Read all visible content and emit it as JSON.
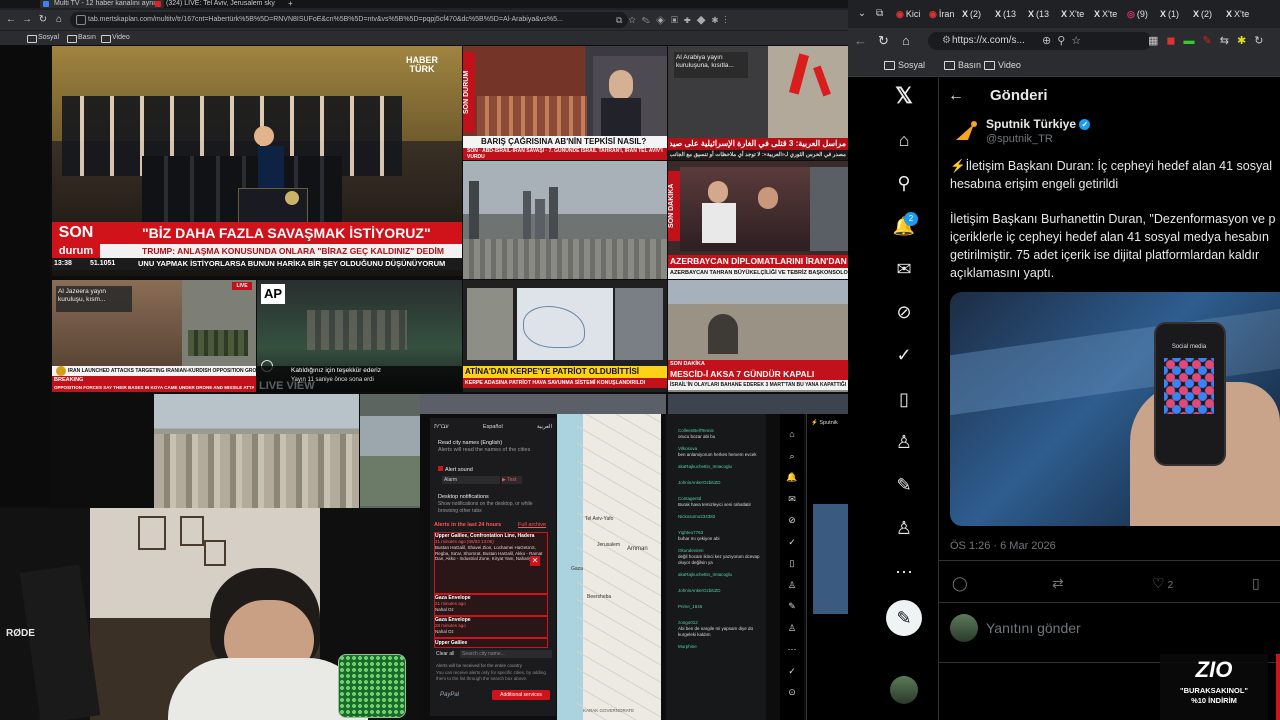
{
  "left_browser": {
    "tabs": [
      {
        "label": "Multi TV - 12 haber kanalını aynı e",
        "color": "#3b82f6",
        "active": true
      },
      {
        "label": "(324) LIVE: Tel Aviv, Jerusalem sky",
        "color": "#e11d2a",
        "active": false
      }
    ],
    "url": "tab.mertskaplan.com/multitv/tr/167cnt=Habertürk%5B%5D=RNVN8ISUFoE&cn%5B%5D=ntv&vs%5B%5D=pqpj5cf470&dc%5B%5D=Al-Arabiya&vs%5...",
    "bookmarks": [
      "Sosyal",
      "Basın",
      "Video"
    ]
  },
  "tiles": {
    "haberturk": {
      "logo_line1": "HABER",
      "logo_line2": "TÜRK",
      "son": "SON",
      "durum": "durum",
      "headline": "\"BİZ DAHA FAZLA SAVAŞMAK İSTİYORUZ\"",
      "subline": "TRUMP: ANLAŞMA KONUSUNDA ONLARA \"BİRAZ GEÇ KALDINIZ\" DEDİM",
      "time": "13:38",
      "ticker_value": "51.1051",
      "ticker": "UNU YAPMAK İSTİYORLARSA BUNUN HARİKA BİR ŞEY OLDUĞUNU DÜŞÜNÜYORUM"
    },
    "ntv": {
      "side_label": "SON DURUM",
      "headline": "BARIŞ ÇAĞRISINA AB'NİN TEPKİSİ NASIL?",
      "sub": "SON · ABD-İSRAİL-İRAN SAVAŞI · 7. GÜNÜNDE İSRAİL TAHRAN'I, İRAN TEL AVİV'İ VURDU"
    },
    "alarabiya": {
      "overlay": "Al Arabiya yayın kuruluşuna, kısıtla...",
      "headline": "مراسل العربية: 3 قتلى في الغارة الإسرائيلية على صيدا",
      "sub": "مصدر في الحرس الثوري لـ«العربية»: لا توجد أي ملاحظات أو تنسيق مع الجانب الأمريكي"
    },
    "cnnturk": {
      "side_label": "SON DAKİKA",
      "headline": "AZERBAYCAN DİPLOMATLARINI İRAN'DAN Ç",
      "sub": "AZERBAYCAN TAHRAN BÜYÜKELÇİLİĞİ VE TEBRİZ BAŞKONSOLOSLUĞUNDAKİ"
    },
    "aljazeera": {
      "overlay": "Al Jazeera yayın kuruluşu, kısm...",
      "live": "LIVE",
      "headline": "IRAN LAUNCHED ATTACKS TARGETING IRANIAN-KURDISH OPPOSITION GROUPS IN IRAQ EARLIER THIS WEEK",
      "breaking": "BREAKING",
      "ticker": "OPPOSITION FORCES SAY THEIR BASES IN KOYA CAME UNDER DRONE AND MISSILE ATTACKS"
    },
    "ap": {
      "logo": "AP",
      "thanks": "Katıldığınız için teşekkür ederiz",
      "ended": "Yayın 11 saniye önce sona erdi",
      "live_view": "LIVE VIEW"
    },
    "map_tile": {
      "headline": "ATİNA'DAN KERPE'YE PATRİOT OLDUBİTTİSİ",
      "sub": "KERPE ADASINA PATRİOT HAVA SAVUNMA SİSTEMİ KONUŞLANDIRILDI"
    },
    "mescid": {
      "label": "SON DAKİKA",
      "headline": "MESCİD-İ AKSA 7 GÜNDÜR KAPALI",
      "sub": "İSRAİL'İN OLAYLARI BAHANE EDEREK 3 MART'TAN BU YANA KAPATTIĞI"
    }
  },
  "alerts_panel": {
    "tabs": [
      "עברית",
      "Español",
      "العربية"
    ],
    "read_city": "Read city names (English)",
    "read_city_sub": "Alerts will read the names of the cities",
    "alert_sound": "Alert sound",
    "sound_value": "Alarm",
    "test": "▶ Test",
    "desktop": "Desktop notifications",
    "desktop_sub": "Show notifications on the desktop, or while browsing other tabs",
    "last24": "Alerts in the last 24 hours",
    "full_archive": "Full archive",
    "alert1_title": "Upper Galilee, Confrontation Line, Hadera",
    "alert1_time": "21 minutes ago (06/03 13:06)",
    "alert1_places": "Bustan HaGalil, Shavei Zion, Lochamei HaGeta'ot, Regba, Sa'ar, Shomrat, Bustan HaGalil, Akko - Ramat Dan, Akko - Industrial Zone, Kiryat Yam, Nahariya",
    "alert2_title": "Gaza Envelope",
    "alert2_time": "21 minutes ago",
    "alert2_places": "Nahal Oz",
    "alert3_title": "Gaza Envelope",
    "alert3_time": "28 minutes ago",
    "alert3_places": "Nahal Oz",
    "alert4_title": "Upper Galilee",
    "clear_all": "Clear all",
    "search_placeholder": "Search city name...",
    "footer": "Alerts will be received for the entire country",
    "footer2": "You can receive alerts only for specific cities, by adding them to the list through the search box above.",
    "paypal": "PayPal",
    "additional": "Additional services"
  },
  "map_labels": [
    "Tel Aviv-Yafo",
    "Jerusalem",
    "Amman",
    "Gaza",
    "Beersheba",
    "KARAK GOVERNORATE"
  ],
  "chat": {
    "messages": [
      {
        "user": "ColleenBellTennis",
        "text": "orucu bozar abi bu"
      },
      {
        "user": "Vilkosova",
        "text": "ben anlamiyorum herkes herxem evcek"
      },
      {
        "user": "akaRajkuchettin_ImIacoglu",
        "text": ""
      },
      {
        "user": "JohninAnkerOzbitiZD",
        "text": ""
      },
      {
        "user": "Contagentd",
        "text": "Burak hava temizleyici seni rahatlatir"
      },
      {
        "user": "Nickosomo234382",
        "text": ""
      },
      {
        "user": "Yighteo7763",
        "text": "buhar mı çekiyon abi"
      },
      {
        "user": "Okundeviren",
        "text": "değil hocam ikinci kez yazıyorum dcevap oluyor değilsin ya"
      },
      {
        "user": "akaRajkuchettin_ImIacoglu",
        "text": ""
      },
      {
        "user": "JohninAnkerOzbitiZD",
        "text": ""
      },
      {
        "user": "Prime_1845",
        "text": ""
      },
      {
        "user": "zongo012",
        "text": "Abi ben de nargile mi yapsam diye dü kurgeleki kaldım"
      },
      {
        "user": "Murphine",
        "text": ""
      }
    ]
  },
  "stream": {
    "mic_brand": "RØDE"
  },
  "right_browser": {
    "tabs": [
      {
        "label": "Kici",
        "glyph": "◉"
      },
      {
        "label": "İran",
        "glyph": "◉"
      },
      {
        "label": "(2)",
        "glyph": "X"
      },
      {
        "label": "(13",
        "glyph": "X"
      },
      {
        "label": "(13",
        "glyph": "X"
      },
      {
        "label": "X'te",
        "glyph": "X"
      },
      {
        "label": "X'te",
        "glyph": "X"
      },
      {
        "label": "(9)",
        "glyph": "◎"
      },
      {
        "label": "(1)",
        "glyph": "X"
      },
      {
        "label": "(2)",
        "glyph": "X"
      },
      {
        "label": "X'te",
        "glyph": "X"
      }
    ],
    "url": "https://x.com/s...",
    "bookmarks": [
      "Sosyal",
      "Basın",
      "Video"
    ]
  },
  "x_app": {
    "notification_count": "2",
    "header_title": "Gönderi",
    "author_name": "Sputnik Türkiye",
    "author_handle": "@sputnik_TR",
    "tweet_line1": "⚡İletişim Başkanı Duran: İç cepheyi hedef alan 41 sosyal",
    "tweet_line2": "hesabına erişim engeli getirildi",
    "tweet_p2_1": "İletişim Başkanı Burhanettin Duran, \"Dezenformasyon ve p",
    "tweet_p2_2": "içeriklerle iç cepheyi hedef alan 41 sosyal medya hesabın",
    "tweet_p2_3": "getirilmiştir. 75 adet içerik ise dijital platformlardan kaldır",
    "tweet_p2_4": "açıklamasını yaptı.",
    "phone_label": "Social media",
    "timestamp": "ÖS 1:26 · 6 Mar 2026",
    "like_count": "2",
    "reply_placeholder": "Yanıtını gönder"
  },
  "promo": {
    "logo": "ZIO",
    "line1": "\"BURAKSAKINOL\"",
    "line2": "%10 İNDİRİM"
  },
  "colors": {
    "x_blue": "#1d9bf0",
    "news_red": "#d0121b",
    "x_bg": "#000000"
  }
}
